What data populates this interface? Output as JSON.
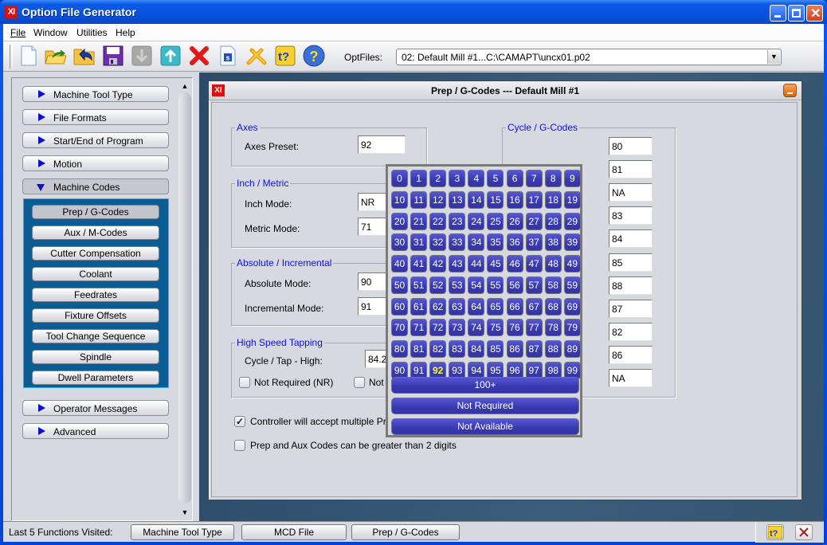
{
  "window": {
    "title": "Option File Generator",
    "app_icon_text": "XI"
  },
  "menu": [
    "File",
    "Window",
    "Utilities",
    "Help"
  ],
  "toolbar": {
    "buttons": [
      "new-file",
      "open-file",
      "revert",
      "save",
      "move-down",
      "move-up",
      "delete",
      "script",
      "tools",
      "context-help",
      "help"
    ],
    "optfiles_label": "OptFiles:",
    "optfiles_value": "02:  Default Mill #1...C:\\CAMAPT\\uncx01.p02"
  },
  "sidebar": {
    "sections": [
      {
        "label": "Machine Tool Type",
        "expanded": false
      },
      {
        "label": "File Formats",
        "expanded": false
      },
      {
        "label": "Start/End of Program",
        "expanded": false
      },
      {
        "label": "Motion",
        "expanded": false
      },
      {
        "label": "Machine Codes",
        "expanded": true
      },
      {
        "label": "Operator Messages",
        "expanded": false
      },
      {
        "label": "Advanced",
        "expanded": false
      }
    ],
    "machine_codes_items": [
      "Prep / G-Codes",
      "Aux / M-Codes",
      "Cutter Compensation",
      "Coolant",
      "Feedrates",
      "Fixture Offsets",
      "Tool Change Sequence",
      "Spindle",
      "Dwell Parameters"
    ],
    "active_item": "Prep / G-Codes"
  },
  "panel": {
    "title": "Prep / G-Codes --- Default Mill #1",
    "axes": {
      "legend": "Axes",
      "preset_label": "Axes Preset:",
      "preset_value": "92"
    },
    "inch_metric": {
      "legend": "Inch / Metric",
      "inch_label": "Inch Mode:",
      "inch_value": "NR",
      "metric_label": "Metric Mode:",
      "metric_value": "71"
    },
    "abs_inc": {
      "legend": "Absolute / Incremental",
      "abs_label": "Absolute Mode:",
      "abs_value": "90",
      "inc_label": "Incremental Mode:",
      "inc_value": "91"
    },
    "tapping": {
      "legend": "High Speed Tapping",
      "cycle_label": "Cycle / Tap - High:",
      "cycle_value": "84.2",
      "not_required_label": "Not Required (NR)",
      "not_required_checked": false,
      "not_available_label": "Not",
      "not_available_checked": false
    },
    "cycle": {
      "legend": "Cycle / G-Codes",
      "values": [
        "80",
        "81",
        "NA",
        "83",
        "84",
        "85",
        "88",
        "87",
        "82",
        "86",
        "NA"
      ]
    },
    "options": [
      {
        "label": "Controller will accept multiple Prep / G-codes",
        "checked": true
      },
      {
        "label": "Prep and Aux Codes can be greater than 2 digits",
        "checked": false
      }
    ]
  },
  "numpad": {
    "selected": 92,
    "more_label": "100+",
    "not_required_label": "Not Required",
    "not_available_label": "Not Available"
  },
  "statusbar": {
    "label": "Last 5 Functions Visited:",
    "history": [
      "Machine Tool Type",
      "MCD File",
      "Prep / G-Codes"
    ]
  }
}
